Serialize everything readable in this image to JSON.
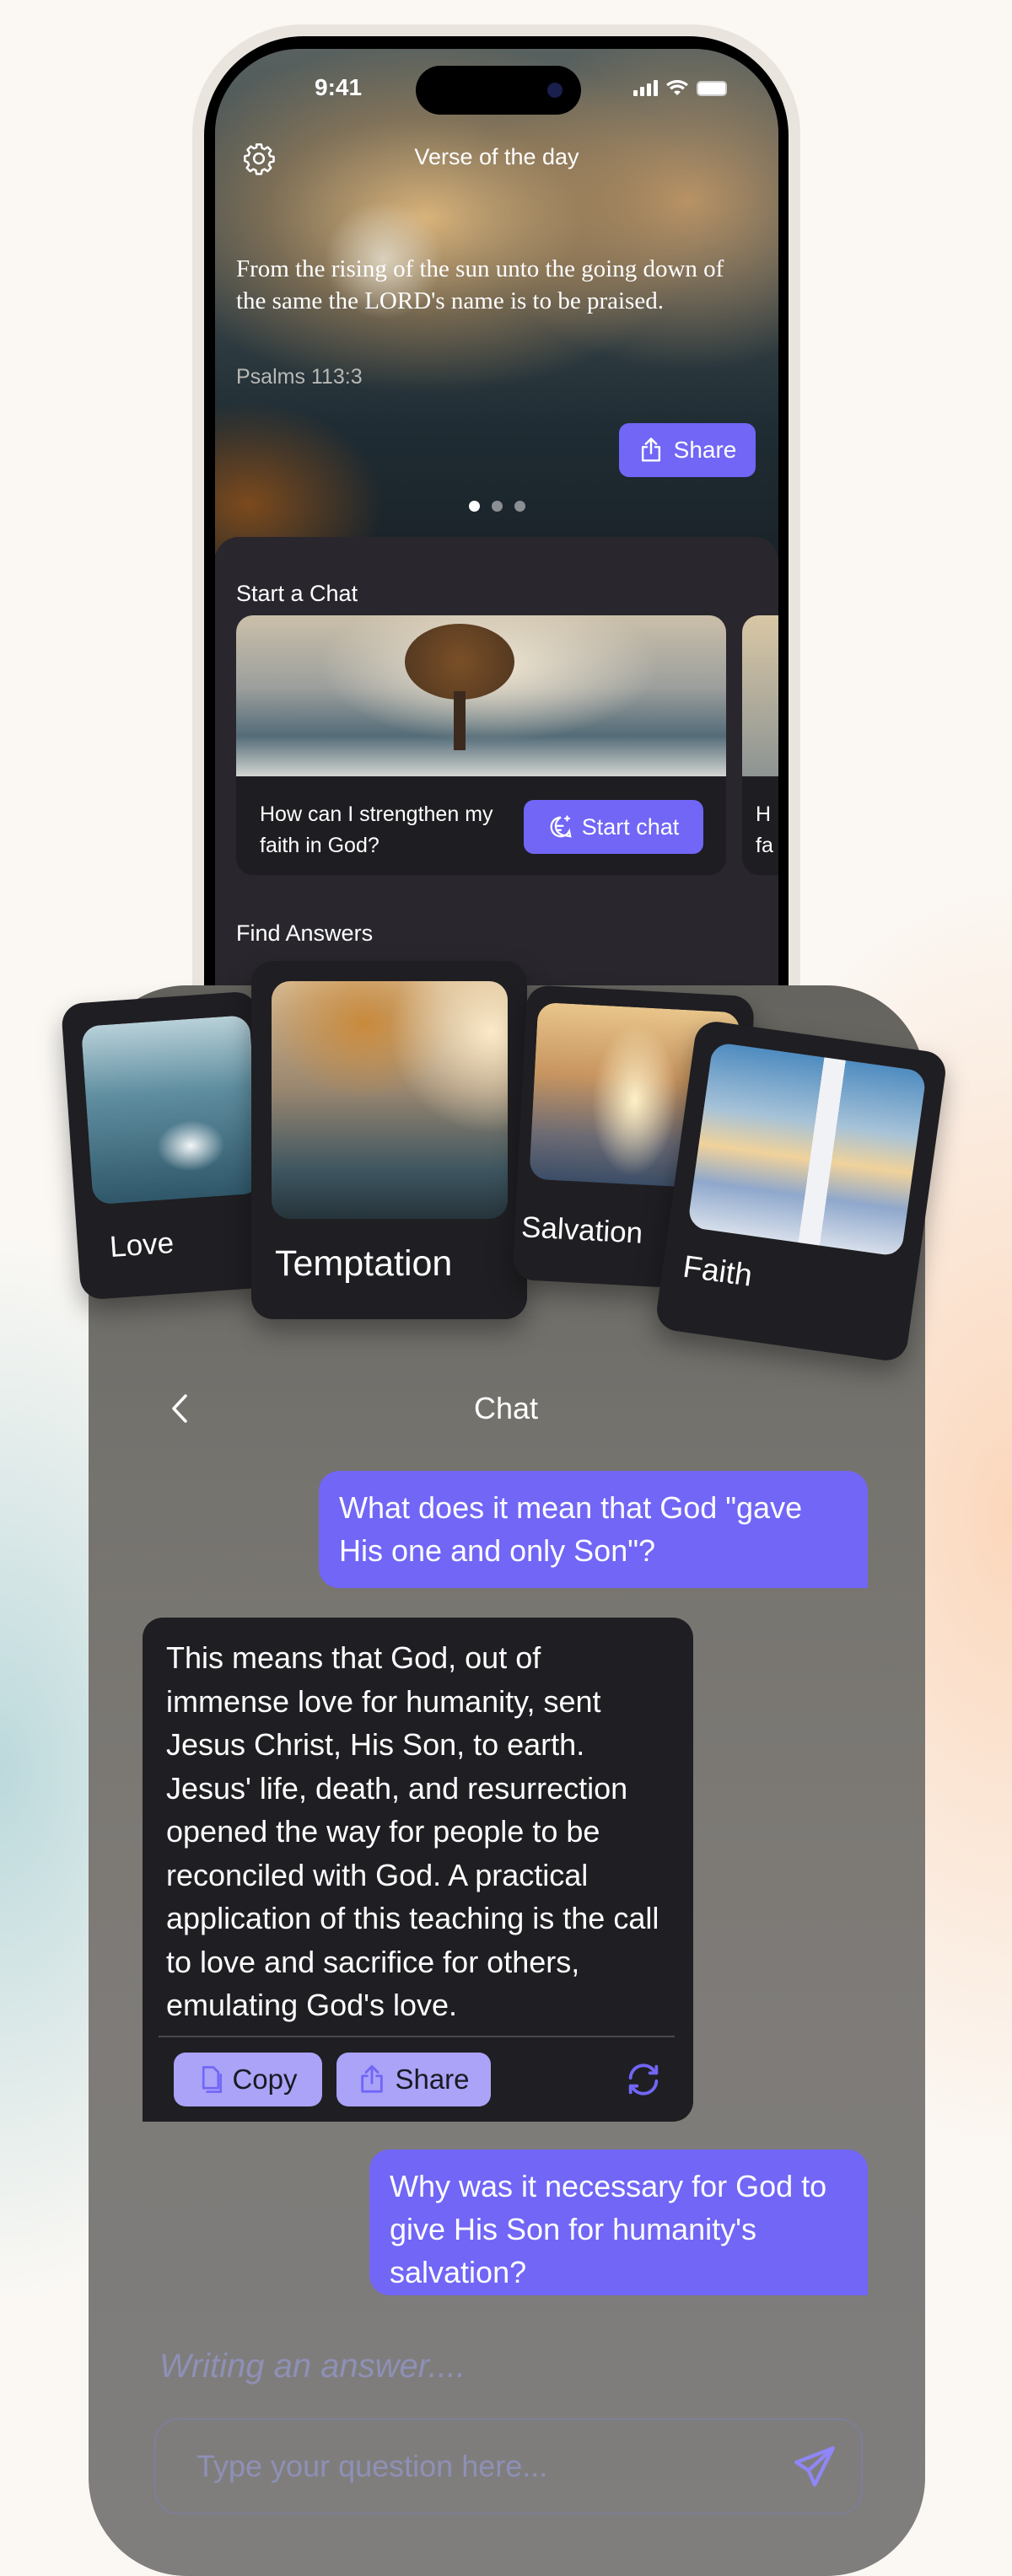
{
  "status_bar": {
    "time": "9:41"
  },
  "verse_card": {
    "title": "Verse of the day",
    "verse": "From the rising of the sun unto the going down of the same the LORD's name is to be praised.",
    "reference": "Psalms 113:3",
    "share_label": "Share",
    "pages": 3,
    "active_page": 1
  },
  "start_chat": {
    "section_title": "Start a Chat",
    "cards": [
      {
        "question": "How can I strengthen my faith in God?",
        "button_label": "Start chat"
      }
    ],
    "next_card_partial": "H fa"
  },
  "find_answers": {
    "section_title": "Find Answers",
    "topics": [
      {
        "label": "Love"
      },
      {
        "label": "Temptation"
      },
      {
        "label": "Salvation"
      },
      {
        "label": "Faith"
      }
    ]
  },
  "chat": {
    "title": "Chat",
    "messages": [
      {
        "role": "user",
        "text": "What does it mean that God \"gave His one and only Son\"?"
      },
      {
        "role": "assistant",
        "text": "This means that God, out of immense love for humanity, sent Jesus Christ, His Son, to earth. Jesus' life, death, and resurrection opened the way for people to be reconciled with God. A practical application of this teaching is the call to love and sacrifice for others, emulating God's love.",
        "copy_label": "Copy",
        "share_label": "Share"
      },
      {
        "role": "user",
        "text": "Why was it necessary for God to give His Son for humanity's salvation?"
      }
    ],
    "typing_status": "Writing an answer....",
    "input_placeholder": "Type your question here..."
  },
  "colors": {
    "accent": "#7166f6",
    "accent_light": "#aaa3f8",
    "panel": "#29272d",
    "bubble_dark": "#1f1e22"
  }
}
